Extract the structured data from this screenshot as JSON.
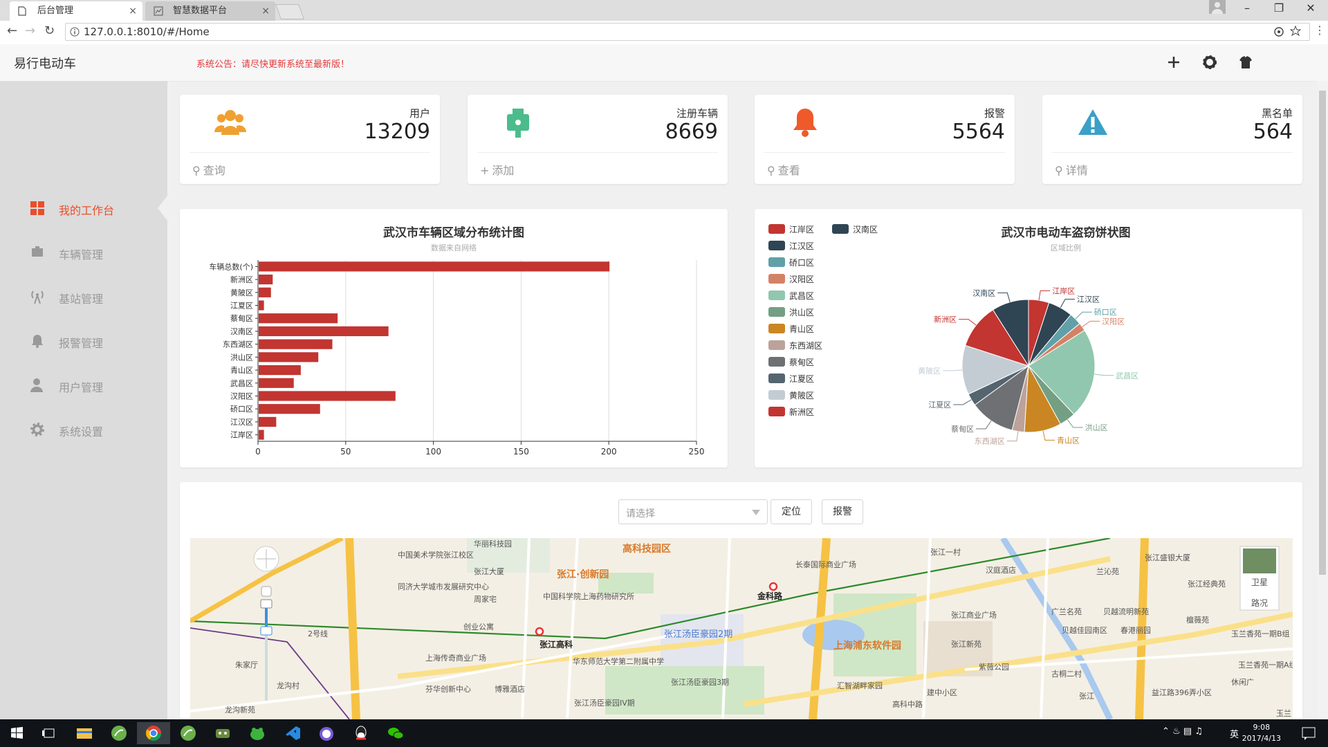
{
  "browser": {
    "tabs": [
      {
        "title": "后台管理",
        "close": "×"
      },
      {
        "title": "智慧数据平台",
        "close": "×"
      }
    ],
    "url": "127.0.0.1:8010/#/Home"
  },
  "header": {
    "brand": "易行电动车",
    "notice": "系统公告：请尽快更新系统至最新版！"
  },
  "sidebar": {
    "items": [
      {
        "label": "我的工作台"
      },
      {
        "label": "车辆管理"
      },
      {
        "label": "基站管理"
      },
      {
        "label": "报警管理"
      },
      {
        "label": "用户管理"
      },
      {
        "label": "系统设置"
      }
    ]
  },
  "stats": [
    {
      "label": "用户",
      "value": "13209",
      "action": "查询",
      "color": "#f0a030"
    },
    {
      "label": "注册车辆",
      "value": "8669",
      "action": "添加",
      "color": "#4cbc8c"
    },
    {
      "label": "报警",
      "value": "5564",
      "action": "查看",
      "color": "#ef5a2a"
    },
    {
      "label": "黑名单",
      "value": "564",
      "action": "详情",
      "color": "#3aa0c8"
    }
  ],
  "chart_data": [
    {
      "type": "bar",
      "orientation": "horizontal",
      "title": "武汉市车辆区域分布统计图",
      "subtitle": "数据来自网络",
      "categories": [
        "江岸区",
        "江汉区",
        "硚口区",
        "汉阳区",
        "武昌区",
        "青山区",
        "洪山区",
        "东西湖区",
        "汉南区",
        "蔡甸区",
        "江夏区",
        "黄陂区",
        "新洲区",
        "车辆总数(个)"
      ],
      "values": [
        3,
        10,
        35,
        78,
        20,
        24,
        34,
        42,
        74,
        45,
        3,
        7,
        8,
        200
      ],
      "xlim": [
        0,
        250
      ],
      "xticks": [
        "0",
        "50",
        "100",
        "150",
        "200",
        "250"
      ],
      "grid": true,
      "color": "#c23531"
    },
    {
      "type": "pie",
      "title": "武汉市电动车盗窃饼状图",
      "subtitle": "区域比例",
      "legend_position": "left",
      "slices": [
        {
          "name": "江岸区",
          "value": 5,
          "color": "#c23531"
        },
        {
          "name": "江汉区",
          "value": 6,
          "color": "#2f4554"
        },
        {
          "name": "硚口区",
          "value": 3,
          "color": "#61a0a8"
        },
        {
          "name": "汉阳区",
          "value": 2,
          "color": "#d48265"
        },
        {
          "name": "武昌区",
          "value": 22,
          "color": "#91c7ae"
        },
        {
          "name": "洪山区",
          "value": 4,
          "color": "#749f83"
        },
        {
          "name": "青山区",
          "value": 9,
          "color": "#ca8622"
        },
        {
          "name": "东西湖区",
          "value": 3,
          "color": "#bda29a"
        },
        {
          "name": "蔡甸区",
          "value": 11,
          "color": "#6e7074"
        },
        {
          "name": "江夏区",
          "value": 3,
          "color": "#546570"
        },
        {
          "name": "黄陂区",
          "value": 12,
          "color": "#c4ccd3"
        },
        {
          "name": "新洲区",
          "value": 11,
          "color": "#c23531"
        },
        {
          "name": "汉南区",
          "value": 9,
          "color": "#2f4554"
        }
      ]
    }
  ],
  "map": {
    "select_placeholder": "请选择",
    "locate_label": "定位",
    "alarm_label": "报警",
    "satellite_label": "卫星",
    "traffic_label": "路况",
    "labels": [
      {
        "text": "华丽科技园",
        "cls": ""
      },
      {
        "text": "中国美术学院张江校区",
        "cls": ""
      },
      {
        "text": "张江大厦",
        "cls": ""
      },
      {
        "text": "同济大学城市发展研究中心",
        "cls": ""
      },
      {
        "text": "周家宅",
        "cls": ""
      },
      {
        "text": "中国科学院上海药物研究所",
        "cls": ""
      },
      {
        "text": "张江·创新园",
        "cls": "big"
      },
      {
        "text": "高科技园区",
        "cls": "big"
      },
      {
        "text": "长泰国际商业广场",
        "cls": ""
      },
      {
        "text": "金科路",
        "cls": "sub"
      },
      {
        "text": "张江一村",
        "cls": ""
      },
      {
        "text": "汉庭酒店",
        "cls": ""
      },
      {
        "text": "兰沁苑",
        "cls": ""
      },
      {
        "text": "张江盛银大厦",
        "cls": ""
      },
      {
        "text": "张江经典苑",
        "cls": ""
      },
      {
        "text": "创业公寓",
        "cls": ""
      },
      {
        "text": "张江高科",
        "cls": "sub"
      },
      {
        "text": "张江汤臣豪园2期",
        "cls": "blue"
      },
      {
        "text": "上海浦东软件园",
        "cls": "big"
      },
      {
        "text": "张江商业广场",
        "cls": ""
      },
      {
        "text": "广兰名苑",
        "cls": ""
      },
      {
        "text": "贝越流明新苑",
        "cls": ""
      },
      {
        "text": "贝越佳园南区",
        "cls": ""
      },
      {
        "text": "春港丽园",
        "cls": ""
      },
      {
        "text": "檀薇苑",
        "cls": ""
      },
      {
        "text": "朱家厅",
        "cls": ""
      },
      {
        "text": "上海传奇商业广场",
        "cls": ""
      },
      {
        "text": "华东师范大学第二附属中学",
        "cls": ""
      },
      {
        "text": "张江新苑",
        "cls": ""
      },
      {
        "text": "紫薇公园",
        "cls": ""
      },
      {
        "text": "古桐二村",
        "cls": ""
      },
      {
        "text": "玉兰香苑一期B组",
        "cls": ""
      },
      {
        "text": "龙沟村",
        "cls": ""
      },
      {
        "text": "芬华创新中心",
        "cls": ""
      },
      {
        "text": "博雅酒店",
        "cls": ""
      },
      {
        "text": "张江汤臣豪园3期",
        "cls": ""
      },
      {
        "text": "汇智湖畔家园",
        "cls": ""
      },
      {
        "text": "建中小区",
        "cls": ""
      },
      {
        "text": "玉兰香苑一期A组团",
        "cls": ""
      },
      {
        "text": "益江路396弄小区",
        "cls": ""
      },
      {
        "text": "休闲广",
        "cls": ""
      },
      {
        "text": "龙沟新苑",
        "cls": ""
      },
      {
        "text": "张江汤臣豪园IV期",
        "cls": ""
      },
      {
        "text": "高科中路",
        "cls": ""
      },
      {
        "text": "张江",
        "cls": ""
      },
      {
        "text": "2号线",
        "cls": ""
      },
      {
        "text": "玉兰",
        "cls": ""
      }
    ]
  },
  "taskbar": {
    "time": "9:08",
    "date": "2017/4/13",
    "ime": "英"
  }
}
